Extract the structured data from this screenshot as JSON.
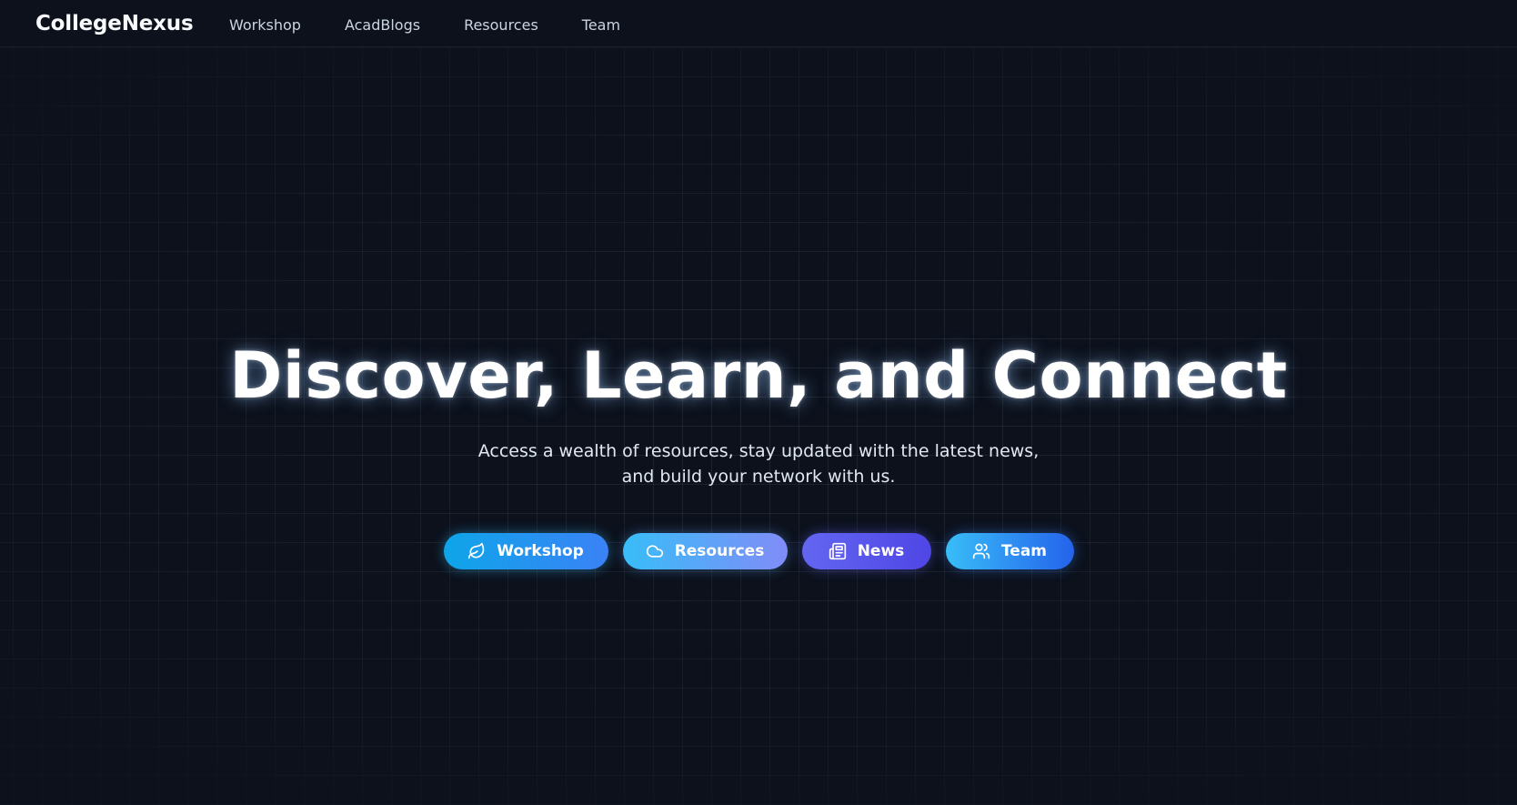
{
  "navbar": {
    "brand": "CollegeNexus",
    "links": [
      {
        "label": "Workshop"
      },
      {
        "label": "AcadBlogs"
      },
      {
        "label": "Resources"
      },
      {
        "label": "Team"
      }
    ]
  },
  "hero": {
    "title": "Discover, Learn, and Connect",
    "subtitle_line1": "Access a wealth of resources, stay updated with the latest news,",
    "subtitle_line2": "and build your network with us.",
    "buttons": [
      {
        "label": "Workshop",
        "icon": "leaf-icon"
      },
      {
        "label": "Resources",
        "icon": "cloud-icon"
      },
      {
        "label": "News",
        "icon": "newspaper-icon"
      },
      {
        "label": "Team",
        "icon": "users-icon"
      }
    ]
  },
  "colors": {
    "background": "#0c111c",
    "grid_line": "#94a3b8",
    "workshop_gradient": [
      "#0ea5e9",
      "#3b82f6"
    ],
    "resources_gradient": [
      "#38bdf8",
      "#818cf8"
    ],
    "news_gradient": [
      "#6366f1",
      "#4f46e5"
    ],
    "team_gradient": [
      "#38bdf8",
      "#2563eb"
    ]
  }
}
